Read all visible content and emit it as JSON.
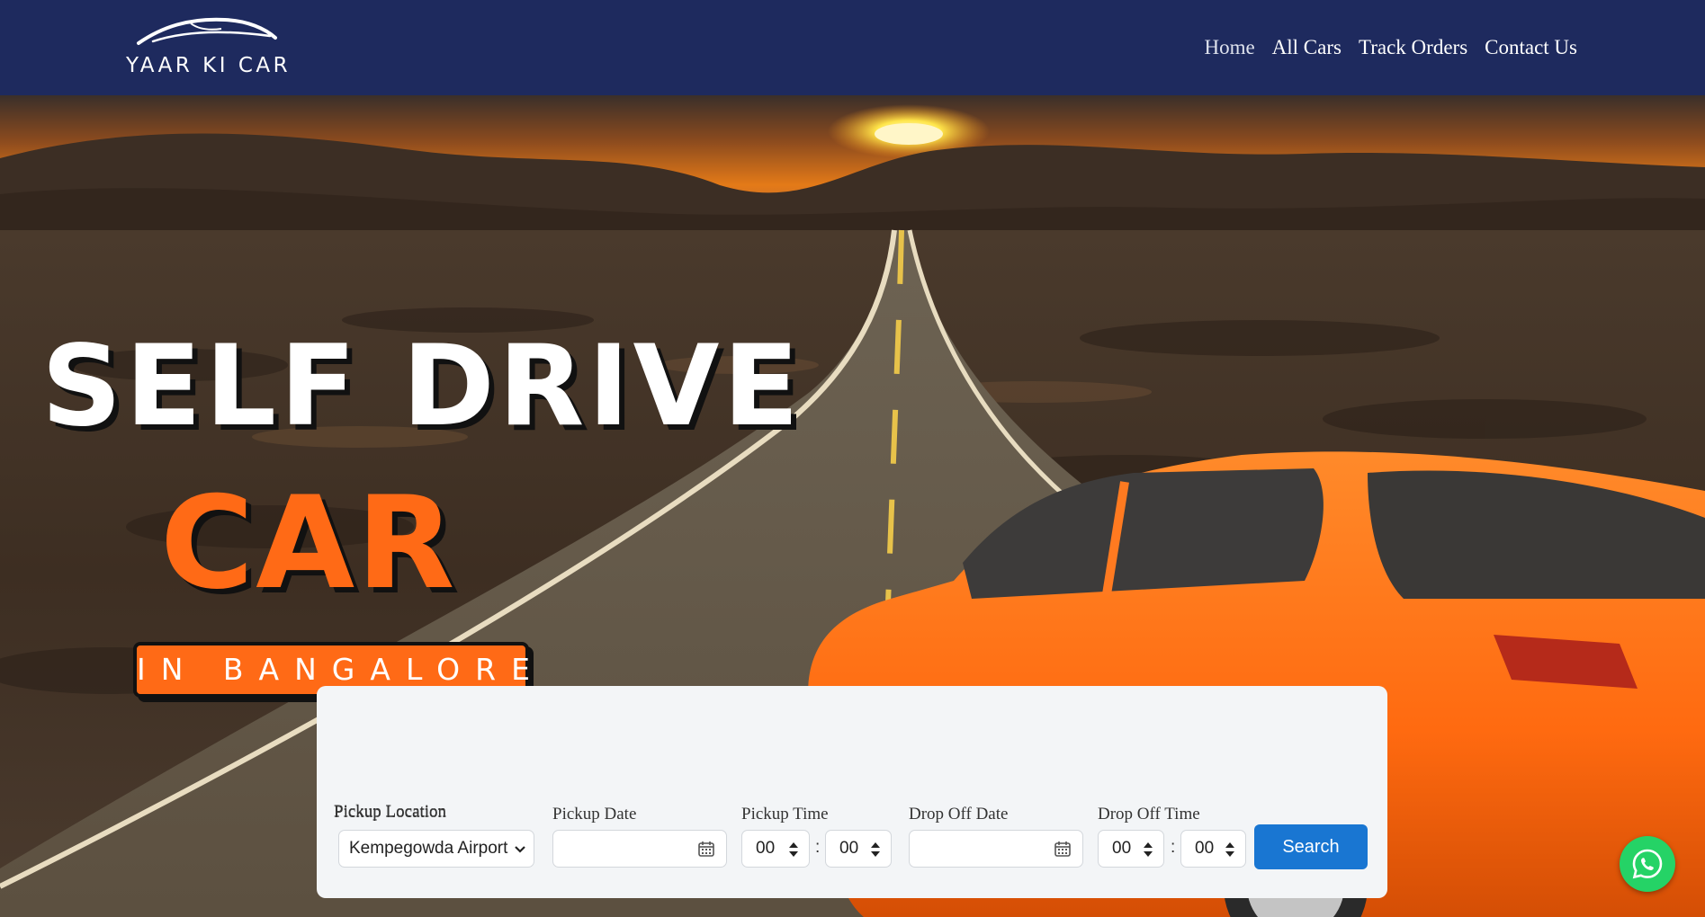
{
  "header": {
    "logo_text": "YAAR KI CAR",
    "nav": [
      "Home",
      "All Cars",
      "Track Orders",
      "Contact Us"
    ]
  },
  "hero": {
    "line1": "SELF DRIVE",
    "line2": "CAR",
    "line3": "IN BANGALORE"
  },
  "search": {
    "pickup_location_label": "Pickup Location",
    "pickup_location_value": "Kempegowda Airport",
    "pickup_date_label": "Pickup Date",
    "pickup_time_label": "Pickup Time",
    "pickup_hour": "00",
    "pickup_minute": "00",
    "dropoff_date_label": "Drop Off Date",
    "dropoff_time_label": "Drop Off Time",
    "dropoff_hour": "00",
    "dropoff_minute": "00",
    "time_separator": ":",
    "button_label": "Search"
  },
  "colors": {
    "header_bg": "#1e2a5e",
    "accent_orange": "#ff6a16",
    "button_blue": "#1976d2",
    "whatsapp_green": "#25d366"
  },
  "icons": [
    "car-logo-icon",
    "chevron-down-icon",
    "calendar-icon",
    "spinner-icon",
    "whatsapp-icon"
  ]
}
